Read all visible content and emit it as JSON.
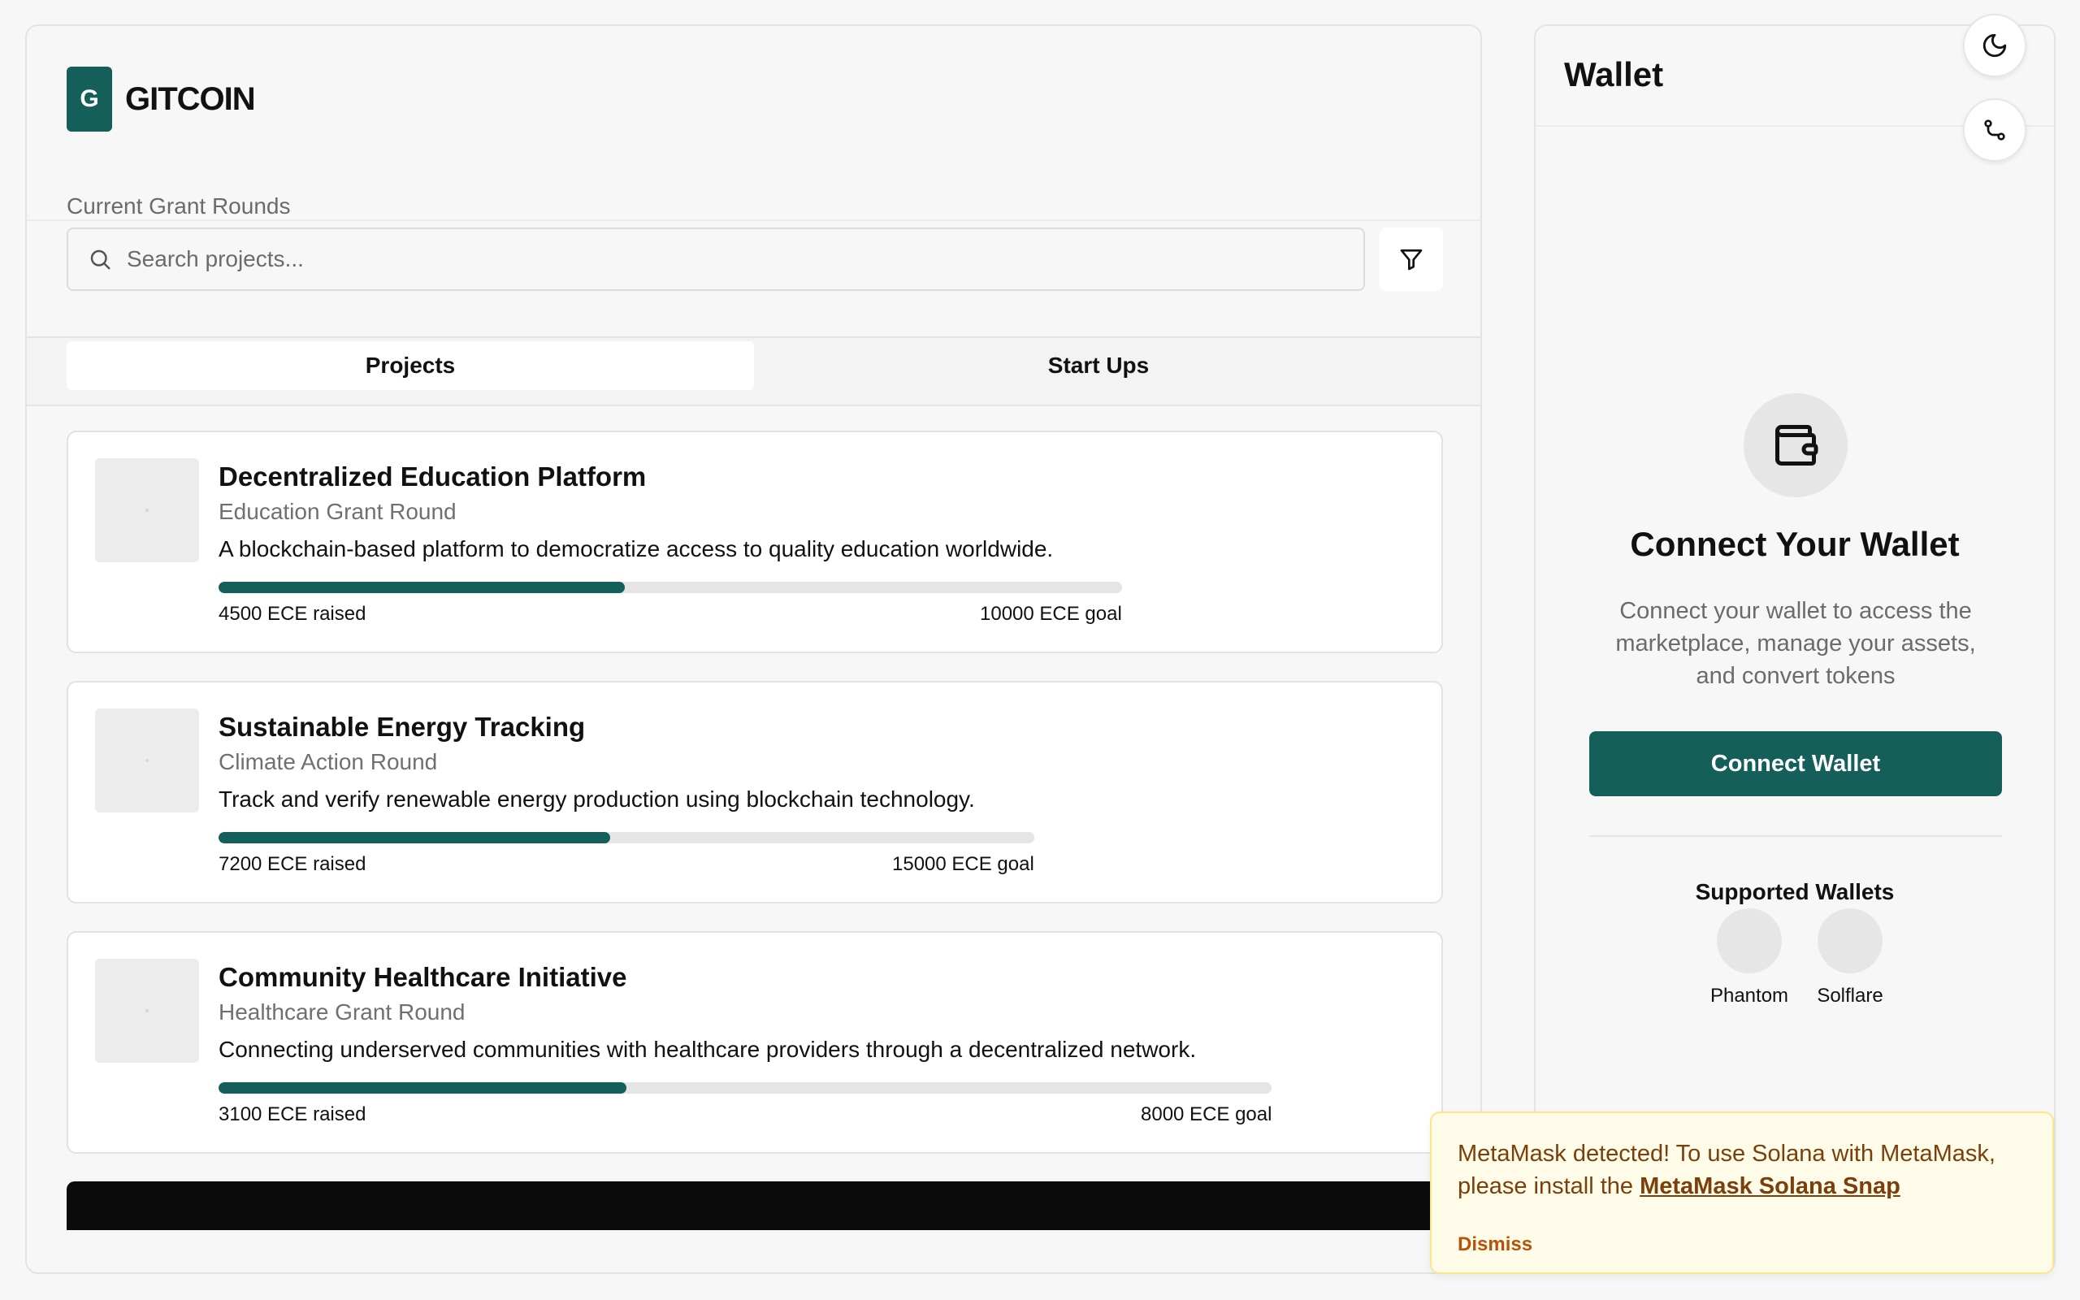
{
  "brand": {
    "logo_letter": "G",
    "name": "GITCOIN"
  },
  "header": {
    "subtitle": "Current Grant Rounds"
  },
  "search": {
    "placeholder": "Search projects..."
  },
  "tabs": [
    {
      "label": "Projects"
    },
    {
      "label": "Start Ups"
    }
  ],
  "projects": [
    {
      "title": "Decentralized Education Platform",
      "round": "Education Grant Round",
      "description": "A blockchain-based platform to democratize access to quality education worldwide.",
      "raised_label": "4500 ECE raised",
      "goal_label": "10000 ECE goal",
      "progress": 0.45
    },
    {
      "title": "Sustainable Energy Tracking",
      "round": "Climate Action Round",
      "description": "Track and verify renewable energy production using blockchain technology.",
      "raised_label": "7200 ECE raised",
      "goal_label": "15000 ECE goal",
      "progress": 0.48
    },
    {
      "title": "Community Healthcare Initiative",
      "round": "Healthcare Grant Round",
      "description": "Connecting underserved communities with healthcare providers through a decentralized network.",
      "raised_label": "3100 ECE raised",
      "goal_label": "8000 ECE goal",
      "progress": 0.3875
    }
  ],
  "wallet": {
    "title": "Wallet",
    "connect_title": "Connect Your Wallet",
    "connect_description": "Connect your wallet to access the marketplace, manage your assets, and convert tokens",
    "connect_button": "Connect Wallet",
    "supported_title": "Supported Wallets",
    "supported": [
      {
        "name": "Phantom"
      },
      {
        "name": "Solflare"
      }
    ]
  },
  "toast": {
    "message_prefix": "MetaMask detected! To use Solana with MetaMask, please install the ",
    "link_text": "MetaMask Solana Snap",
    "dismiss": "Dismiss"
  },
  "colors": {
    "accent": "#145f59",
    "toast_bg": "#fefce8",
    "toast_text": "#7a3f0b"
  },
  "icons": {
    "search": "search-icon",
    "filter": "filter-icon",
    "wallet": "wallet-icon",
    "theme": "moon-icon",
    "route": "route-icon"
  }
}
